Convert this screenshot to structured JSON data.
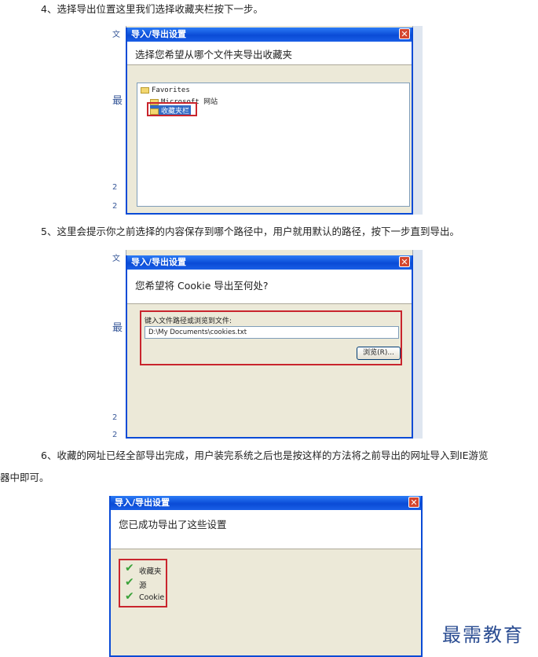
{
  "steps": [
    {
      "text": "4、选择导出位置这里我们选择收藏夹栏按下一步。"
    },
    {
      "text": "5、这里会提示你之前选择的内容保存到哪个路径中，用户就用默认的路径，按下一步直到导出。"
    },
    {
      "text_line1": "6、收藏的网址已经全部导出完成，用户装完系统之后也是按这样的方法将之前导出的网址导入到IE游览",
      "text_line2": "器中即可。"
    }
  ],
  "dialog1": {
    "title": "导入/导出设置",
    "header": "选择您希望从哪个文件夹导出收藏夹",
    "tree": [
      "Favorites",
      "Microsoft 网站",
      "收藏夹栏"
    ]
  },
  "dialog2": {
    "title": "导入/导出设置",
    "header": "您希望将 Cookie 导出至何处?",
    "path_label": "键入文件路径或浏览到文件:",
    "path_value": "D:\\My Documents\\cookies.txt",
    "browse_label": "浏览(R)..."
  },
  "dialog3": {
    "title": "导入/导出设置",
    "header": "您已成功导出了这些设置",
    "items": [
      "收藏夹",
      "源",
      "Cookie"
    ]
  },
  "bg_fragments": {
    "f1": "文",
    "f2": "最",
    "f3": "2",
    "f4": "2",
    "f5": "文",
    "f6": "最",
    "f7": "2",
    "f8": "2"
  },
  "close_glyph": "✕",
  "check_glyph": "✔",
  "watermark": "最需教育",
  "colors": {
    "title_blue": "#0a4bd6",
    "highlight_red": "#c9252d",
    "check_green": "#3aa23a",
    "dialog_bg": "#ece9d8"
  }
}
